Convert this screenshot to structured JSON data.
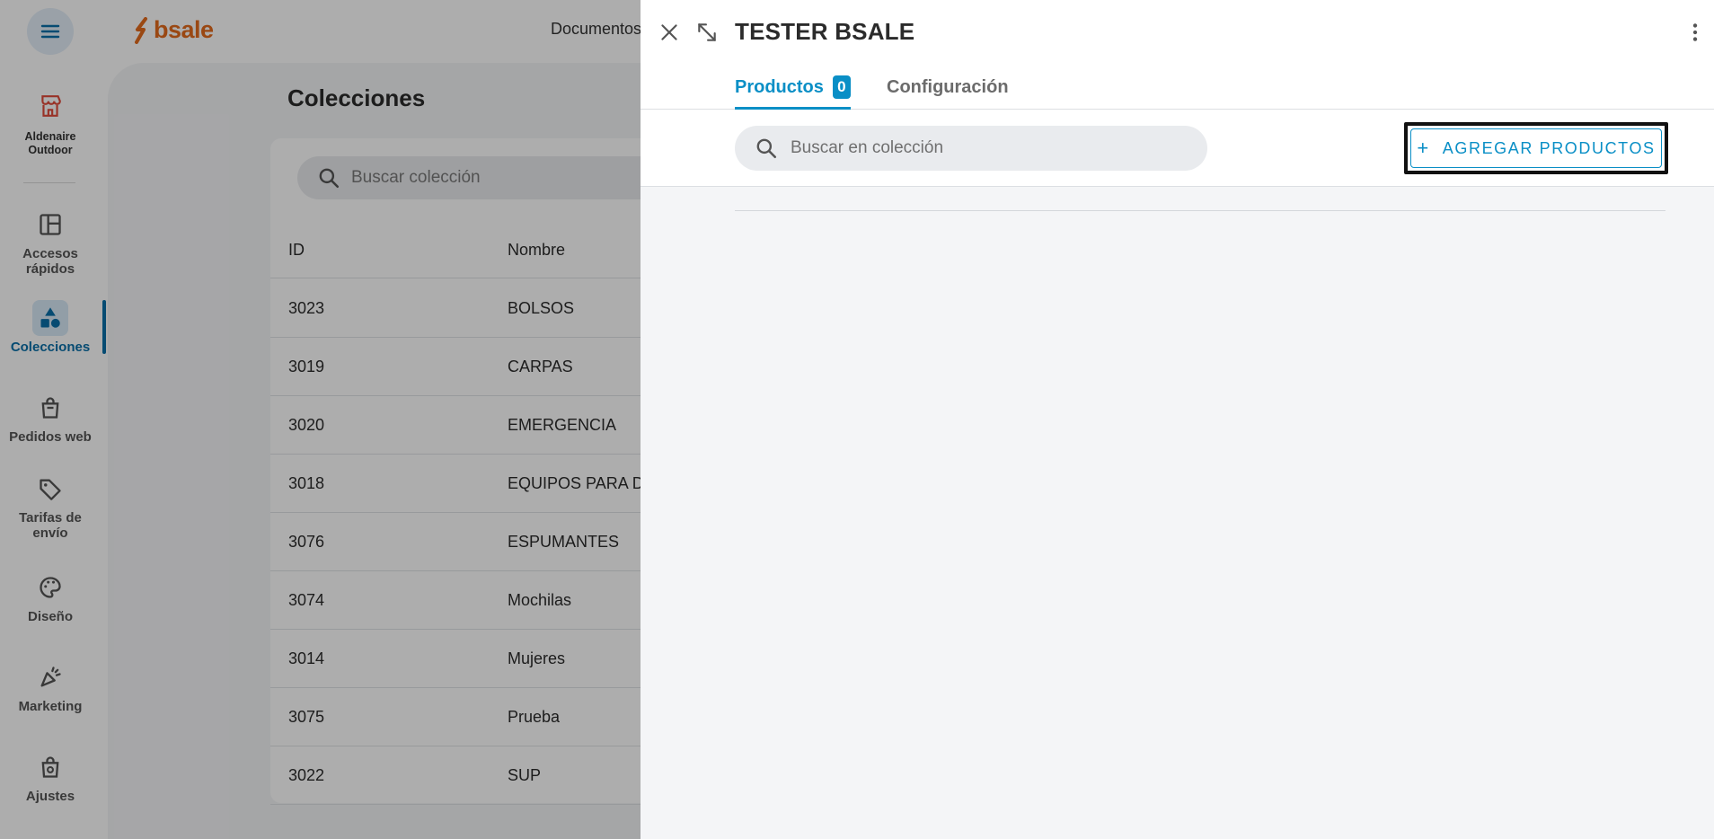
{
  "sidebar": {
    "menu_icon": "hamburger-menu-icon",
    "store": {
      "name_line1": "Aldenaire",
      "name_line2": "Outdoor",
      "icon": "store-icon"
    },
    "items": [
      {
        "label_line1": "Accesos",
        "label_line2": "rápidos",
        "icon": "dashboard-icon"
      },
      {
        "label_line1": "Colecciones",
        "label_line2": "",
        "icon": "shapes-icon",
        "active": true
      },
      {
        "label_line1": "Pedidos web",
        "label_line2": "",
        "icon": "shopping-bag-icon"
      },
      {
        "label_line1": "Tarifas de",
        "label_line2": "envío",
        "icon": "tag-icon"
      },
      {
        "label_line1": "Diseño",
        "label_line2": "",
        "icon": "palette-icon"
      },
      {
        "label_line1": "Marketing",
        "label_line2": "",
        "icon": "megaphone-icon"
      },
      {
        "label_line1": "Ajustes",
        "label_line2": "",
        "icon": "settings-bag-icon"
      }
    ]
  },
  "topbar": {
    "logo_text": "bsale",
    "nav_link": "Documentos"
  },
  "collections_page": {
    "title": "Colecciones",
    "search_placeholder": "Buscar colección",
    "columns": {
      "id": "ID",
      "name": "Nombre"
    },
    "rows": [
      {
        "id": "3023",
        "name": "BOLSOS"
      },
      {
        "id": "3019",
        "name": "CARPAS"
      },
      {
        "id": "3020",
        "name": "EMERGENCIA"
      },
      {
        "id": "3018",
        "name": "EQUIPOS PARA DO"
      },
      {
        "id": "3076",
        "name": "ESPUMANTES"
      },
      {
        "id": "3074",
        "name": "Mochilas"
      },
      {
        "id": "3014",
        "name": "Mujeres"
      },
      {
        "id": "3075",
        "name": "Prueba"
      },
      {
        "id": "3022",
        "name": "SUP"
      }
    ]
  },
  "panel": {
    "title": "TESTER BSALE",
    "tabs": [
      {
        "label": "Productos",
        "badge": "0",
        "active": true
      },
      {
        "label": "Configuración",
        "active": false
      }
    ],
    "search_placeholder": "Buscar en colección",
    "add_button": {
      "plus": "+",
      "label": "AGREGAR PRODUCTOS"
    }
  },
  "colors": {
    "brand_orange": "#e46a1d",
    "accent_blue": "#0a8fc6",
    "sidebar_active": "#0a6fa8",
    "overlay": "rgba(0,0,0,0.32)"
  }
}
